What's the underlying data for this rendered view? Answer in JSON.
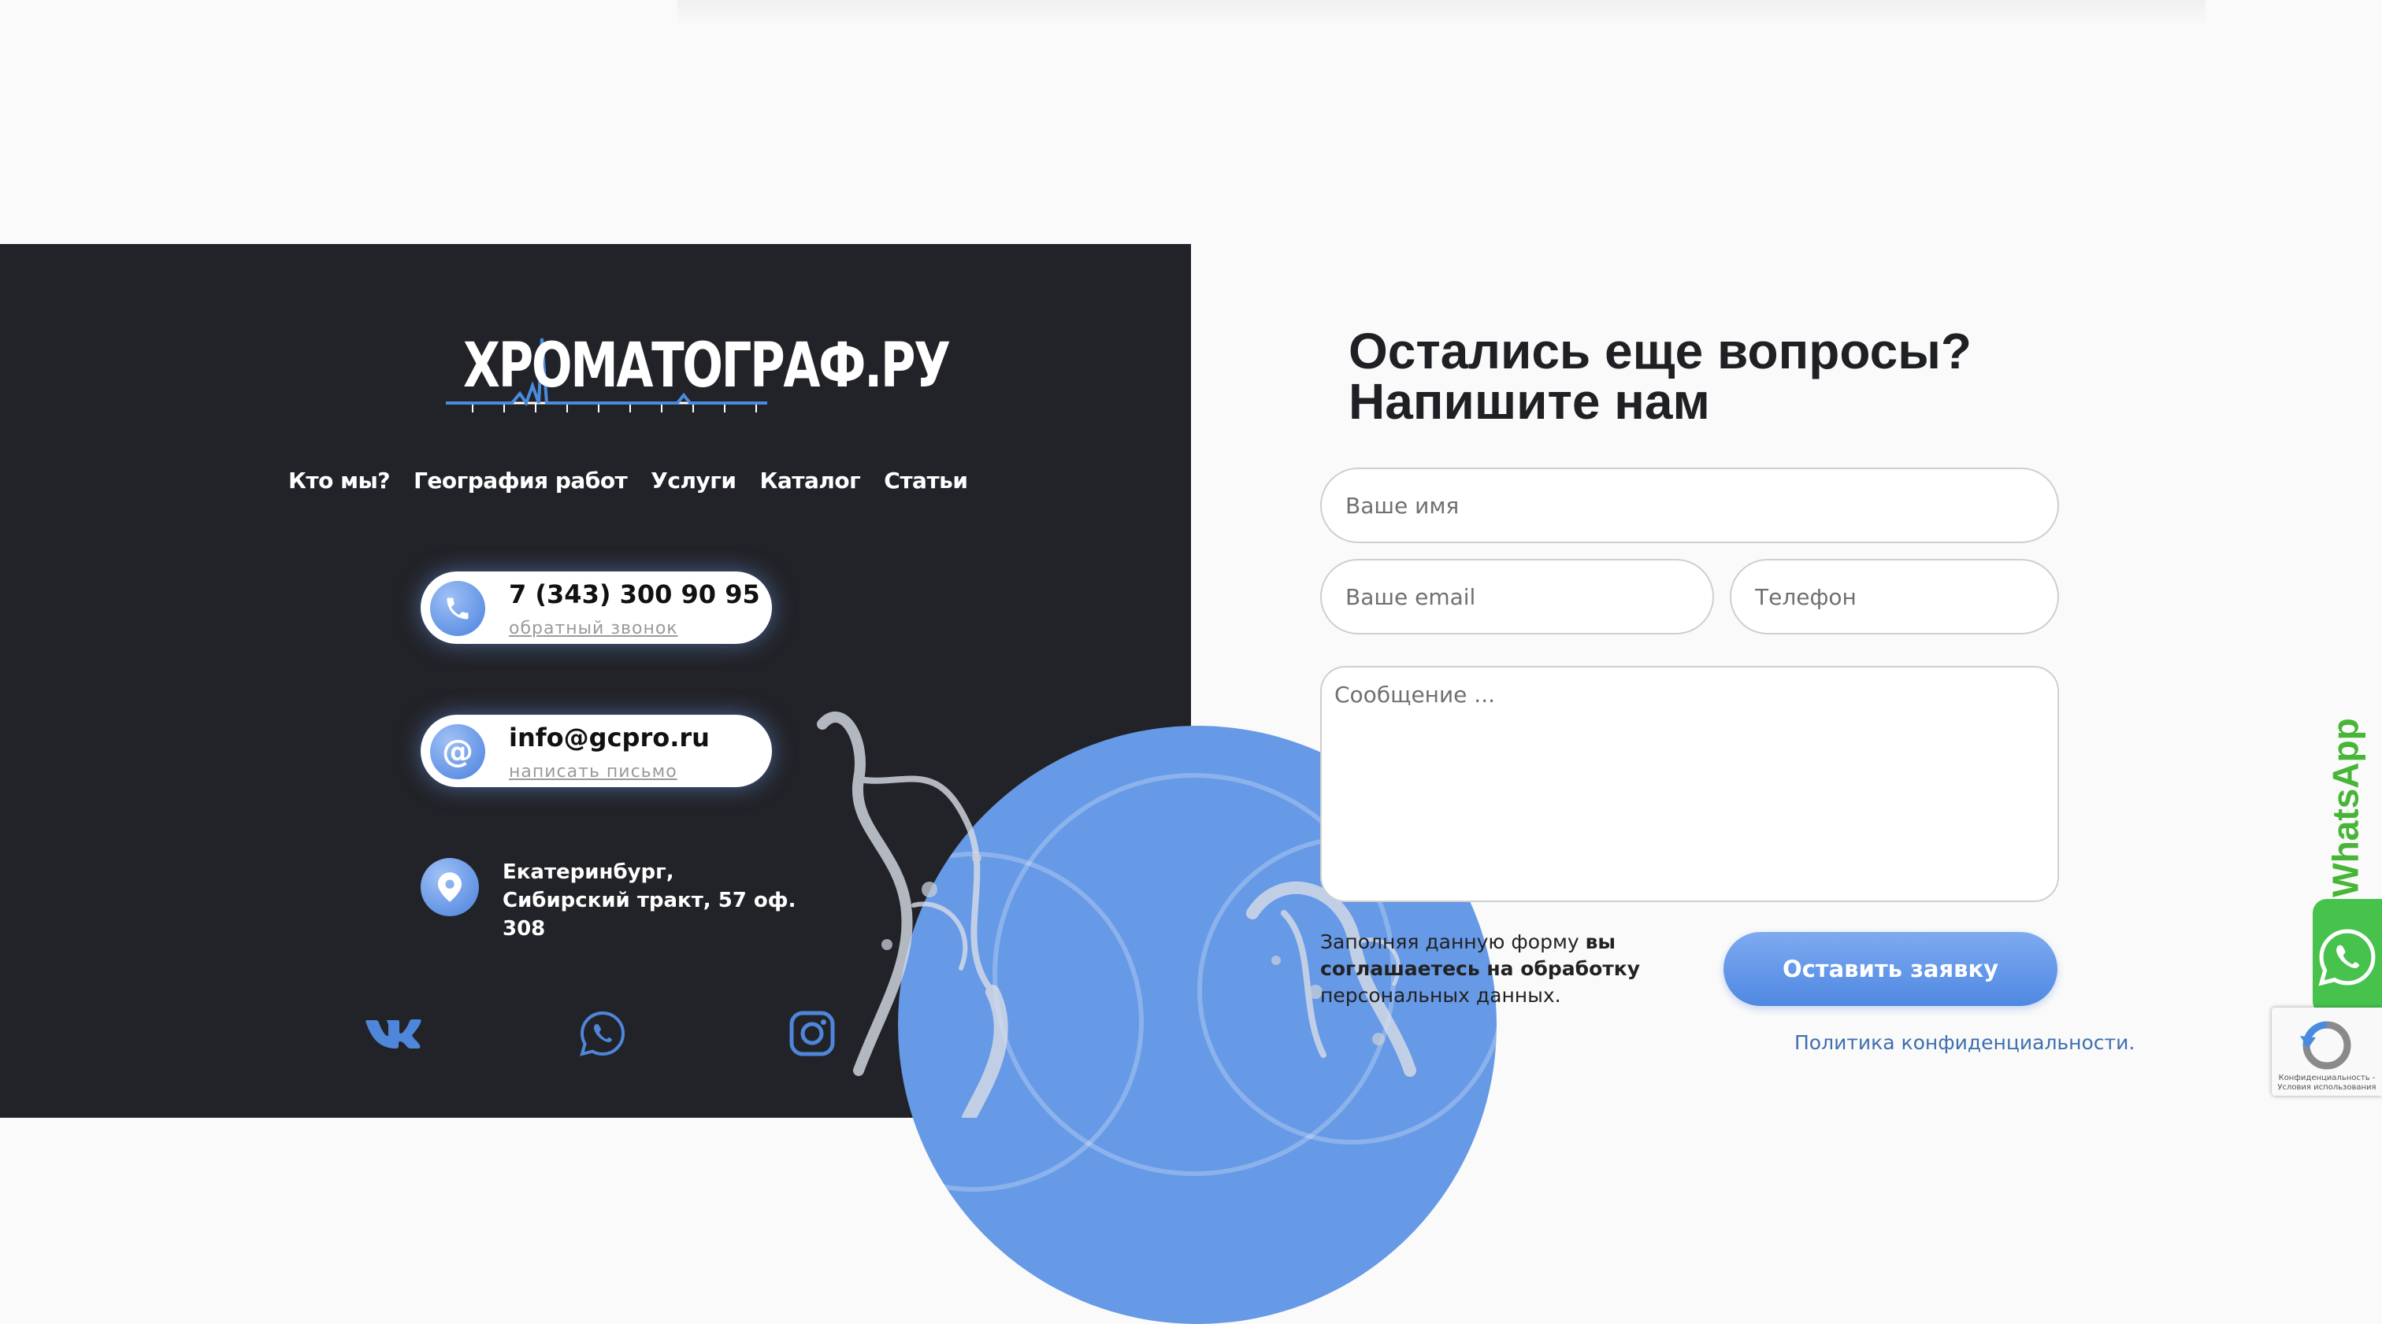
{
  "logo": {
    "text": "ХРОМАТОГРАФ.РУ"
  },
  "nav": {
    "items": [
      {
        "label": "Кто мы?"
      },
      {
        "label": "География работ"
      },
      {
        "label": "Услуги"
      },
      {
        "label": "Каталог"
      },
      {
        "label": "Статьи"
      }
    ]
  },
  "contacts": {
    "phone": {
      "number": "7 (343) 300 90 95",
      "action": "обратный звонок",
      "icon": "phone-icon"
    },
    "email": {
      "address": "info@gcpro.ru",
      "action": "написать письмо",
      "icon": "at-icon"
    },
    "address": {
      "text": "Екатеринбург, Сибирский тракт, 57 оф. 308",
      "icon": "map-pin-icon"
    }
  },
  "social": [
    "vk-icon",
    "whatsapp-icon",
    "instagram-icon"
  ],
  "form": {
    "title_line1": "Остались еще вопросы?",
    "title_line2": "Напишите нам",
    "name_placeholder": "Ваше имя",
    "email_placeholder": "Ваше email",
    "phone_placeholder": "Телефон",
    "message_placeholder": "Сообщение ...",
    "consent_prefix": "Заполняя данную форму ",
    "consent_bold": "вы соглашаетесь на обработку",
    "consent_suffix": " персональных данных.",
    "submit_label": "Оставить заявку",
    "policy_link": "Политика конфиденциальности."
  },
  "whatsapp_widget": {
    "label": "WhatsApp"
  },
  "recaptcha": {
    "text": "Конфиденциальность - Условия использования"
  },
  "colors": {
    "dark_panel": "#222328",
    "accent_blue": "#5b8fe3",
    "link_blue": "#3d6fb0",
    "whatsapp_green": "#47c24d",
    "page_bg": "#fafafa"
  }
}
